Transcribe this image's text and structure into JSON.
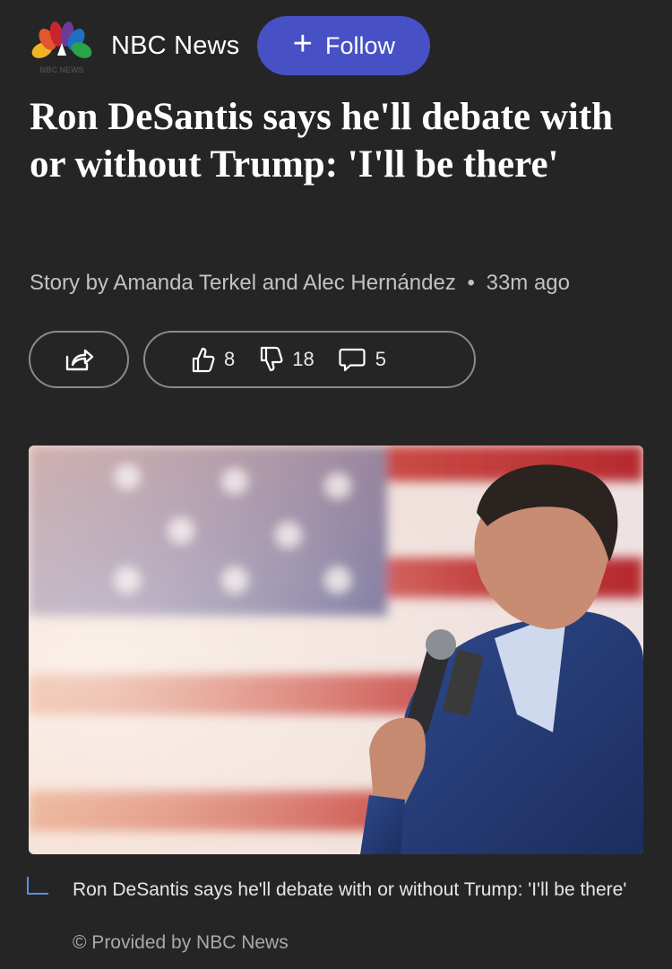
{
  "publisher": {
    "name": "NBC News",
    "logo_text": "NBC NEWS",
    "follow_label": "Follow",
    "follow_icon": "+"
  },
  "article": {
    "headline": "Ron DeSantis says he'll debate with or without Trump: 'I'll be there'",
    "byline": "Story by Amanda Terkel and Alec Hernández",
    "separator": "•",
    "time_ago": "33m ago"
  },
  "actions": {
    "share_icon": "share-icon",
    "likes": "8",
    "dislikes": "18",
    "comments": "5"
  },
  "image": {
    "caption": "Ron DeSantis says he'll debate with or without Trump: 'I'll be there'",
    "credit": "© Provided by NBC News"
  },
  "colors": {
    "background": "#252526",
    "follow_button": "#4850c6",
    "caption_accent": "#5b8fe0"
  }
}
